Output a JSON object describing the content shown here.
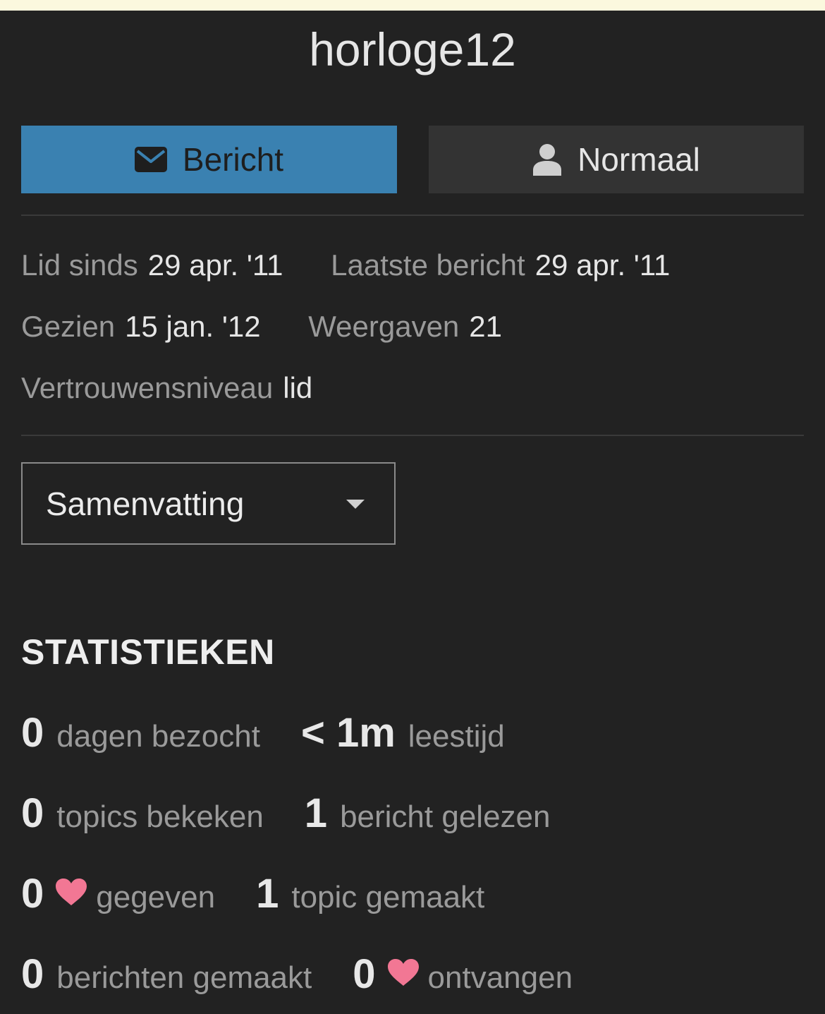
{
  "profile": {
    "username": "horloge12"
  },
  "actions": {
    "message_label": "Bericht",
    "level_label": "Normaal"
  },
  "meta": {
    "member_since_label": "Lid sinds",
    "member_since_value": "29 apr. '11",
    "last_post_label": "Laatste bericht",
    "last_post_value": "29 apr. '11",
    "seen_label": "Gezien",
    "seen_value": "15 jan. '12",
    "views_label": "Weergaven",
    "views_value": "21",
    "trust_label": "Vertrouwensniveau",
    "trust_value": "lid"
  },
  "view_select": {
    "selected": "Samenvatting"
  },
  "stats": {
    "heading": "STATISTIEKEN",
    "days_visited": {
      "value": "0",
      "label": "dagen bezocht"
    },
    "read_time": {
      "value": "< 1m",
      "label": "leestijd"
    },
    "topics_viewed": {
      "value": "0",
      "label": "topics bekeken"
    },
    "posts_read": {
      "value": "1",
      "label": "bericht gelezen"
    },
    "likes_given": {
      "value": "0",
      "label": "gegeven"
    },
    "topics_created": {
      "value": "1",
      "label": "topic gemaakt"
    },
    "posts_created": {
      "value": "0",
      "label": "berichten gemaakt"
    },
    "likes_received": {
      "value": "0",
      "label": "ontvangen"
    }
  },
  "colors": {
    "primary_button": "#3a81b1",
    "heart": "#f27794",
    "background": "#222222",
    "notice_strip": "#fbf8de"
  },
  "icons": {
    "message": "envelope-icon",
    "level": "user-icon",
    "dropdown": "caret-down-icon",
    "like": "heart-icon"
  }
}
